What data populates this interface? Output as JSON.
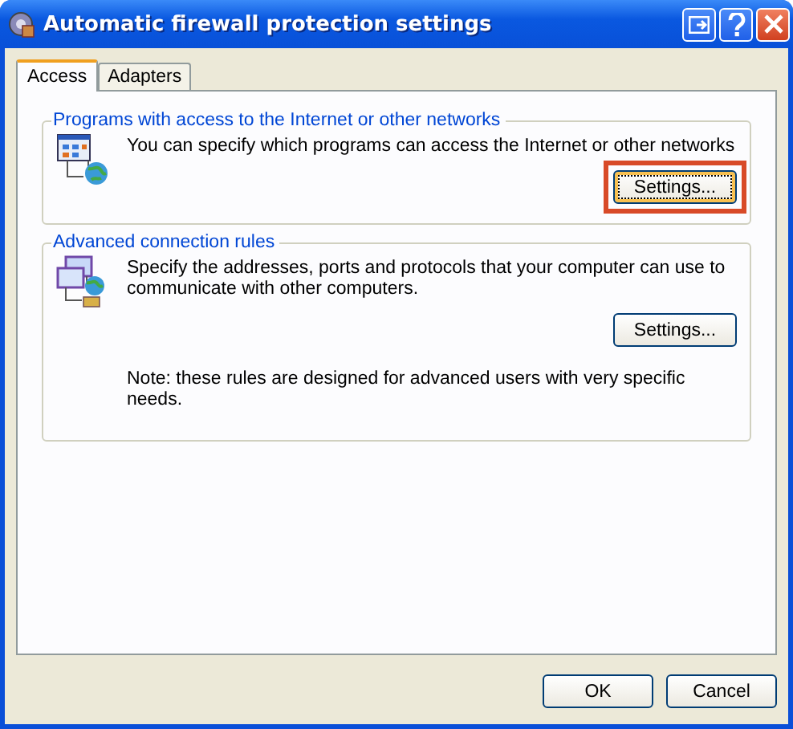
{
  "window": {
    "title": "Automatic firewall protection settings"
  },
  "tabs": [
    {
      "label": "Access",
      "selected": true
    },
    {
      "label": "Adapters",
      "selected": false
    }
  ],
  "groups": [
    {
      "kind": "programs",
      "title": "Programs with access to the Internet or other networks",
      "description": "You can specify which programs can access the Internet or other networks",
      "button": {
        "label": "Settings...",
        "highlighted": true
      }
    },
    {
      "kind": "rules",
      "title": "Advanced connection rules",
      "description": "Specify the addresses, ports and protocols that your computer can use to communicate with other computers.",
      "button": {
        "label": "Settings...",
        "highlighted": false
      },
      "note": "Note: these rules are designed for advanced users with very specific needs."
    }
  ],
  "buttons": [
    "OK",
    "Cancel"
  ]
}
